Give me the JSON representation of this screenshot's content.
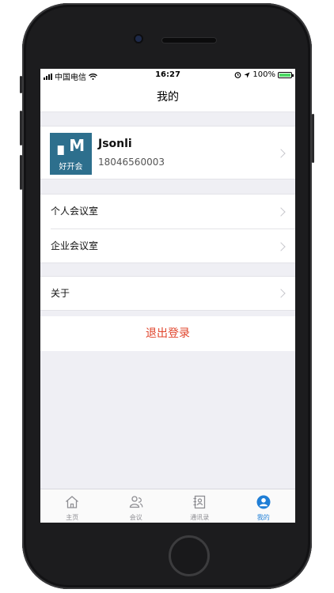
{
  "status_bar": {
    "carrier": "中国电信",
    "time": "16:27",
    "battery_percent": "100%",
    "battery_level": 1.0
  },
  "navbar": {
    "title": "我的"
  },
  "profile": {
    "logo_mark": "▖M",
    "logo_text": "好开会",
    "username": "Jsonli",
    "phone": "18046560003"
  },
  "menu": {
    "personal_room": "个人会议室",
    "company_room": "企业会议室",
    "about": "关于"
  },
  "logout_label": "退出登录",
  "tabs": [
    {
      "label": "主页",
      "icon": "home-icon"
    },
    {
      "label": "会议",
      "icon": "meeting-icon"
    },
    {
      "label": "通讯录",
      "icon": "contacts-icon"
    },
    {
      "label": "我的",
      "icon": "profile-icon",
      "active": true
    }
  ],
  "colors": {
    "accent": "#1f7ed6",
    "logout": "#e0442b",
    "logo_bg": "#2d6f8d"
  }
}
